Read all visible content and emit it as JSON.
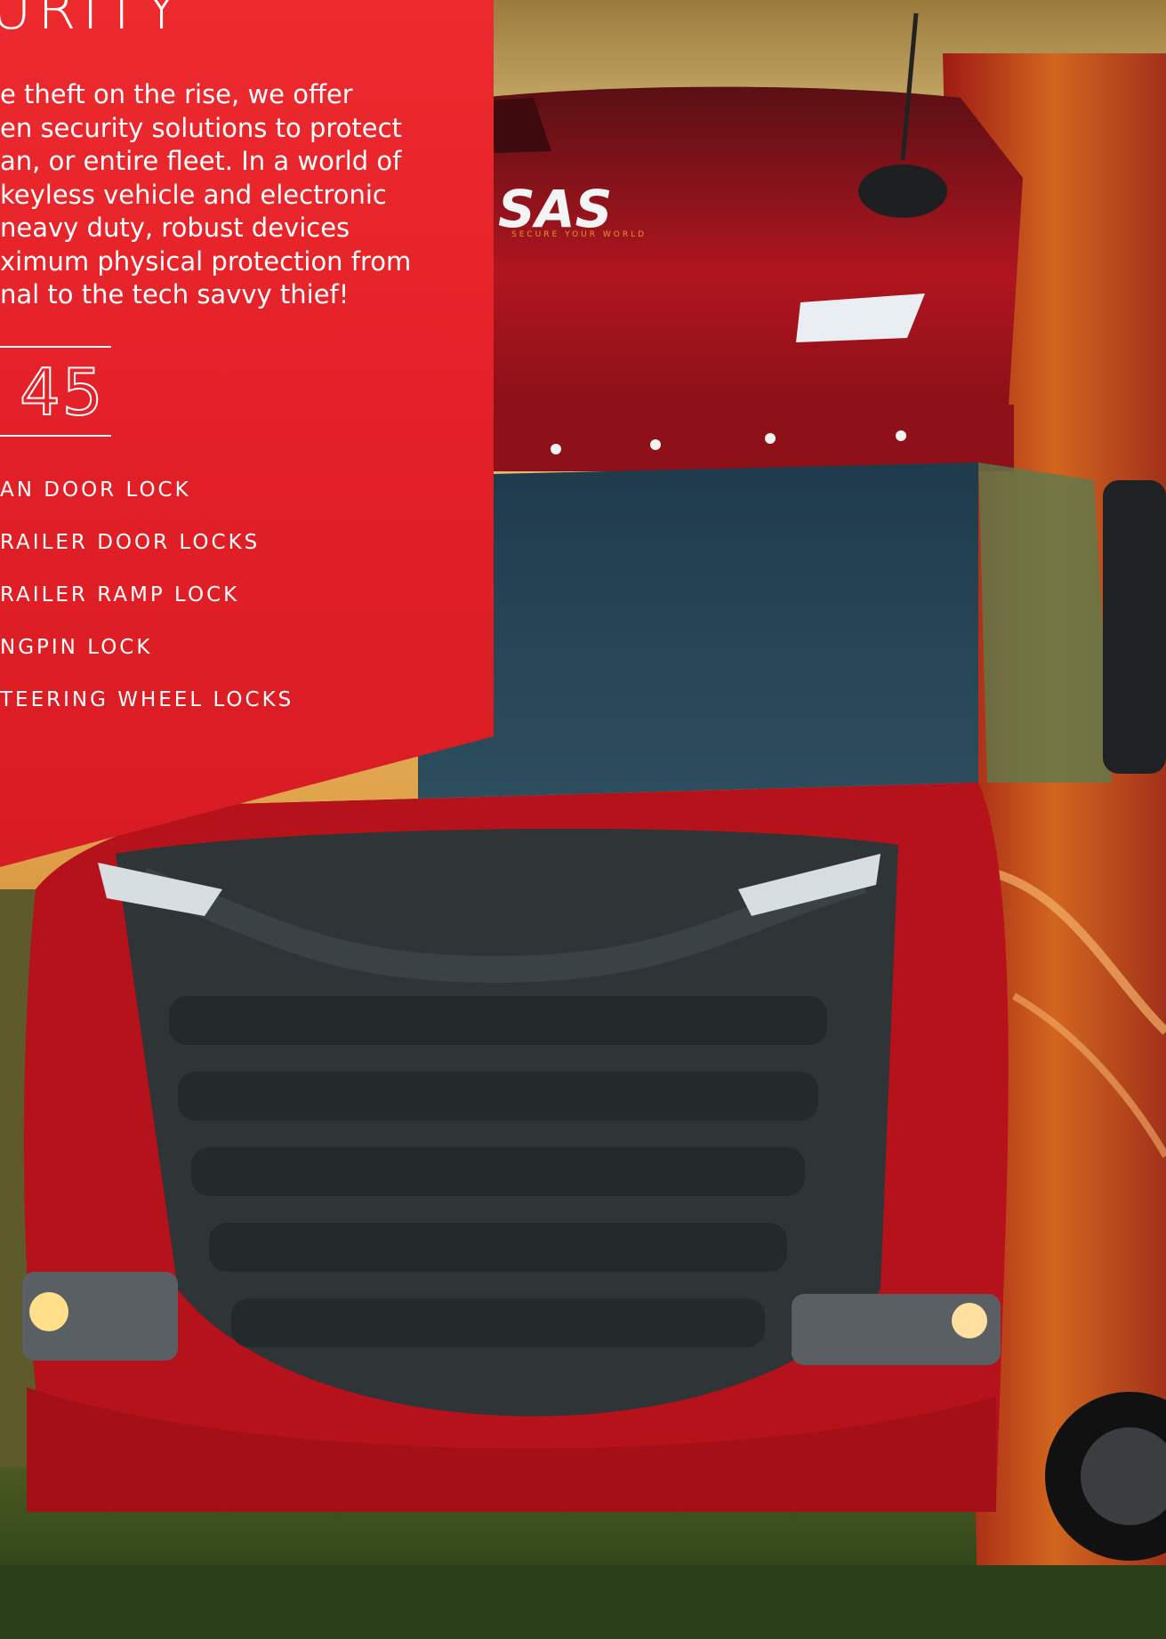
{
  "panel": {
    "title": "URITY",
    "intro_lines": [
      "e theft on the rise, we offer",
      "en security solutions to protect",
      "an, or entire fleet. In a world of",
      "keyless vehicle and electronic",
      "neavy duty, robust devices",
      "ximum physical protection from",
      "nal to the tech savvy thief!"
    ],
    "page_number": "45",
    "products": [
      "AN DOOR LOCK",
      "RAILER DOOR LOCKS",
      "RAILER RAMP LOCK",
      "NGPIN LOCK",
      "TEERING WHEEL LOCKS"
    ]
  },
  "photo": {
    "brand": "SAS",
    "brand_tagline": "SECURE YOUR WORLD"
  },
  "colors": {
    "panel_red": "#e4222a",
    "truck_red": "#b5121b",
    "grille": "#2f3436",
    "sky": "#e9c46a"
  }
}
